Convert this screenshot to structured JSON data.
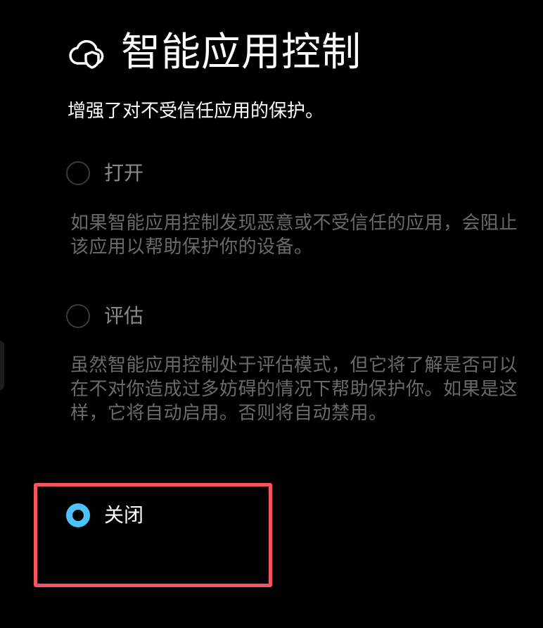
{
  "header": {
    "icon": "cloud-shield-icon",
    "title": "智能应用控制"
  },
  "subtitle": "增强了对不受信任应用的保护。",
  "options": [
    {
      "label": "打开",
      "description": "如果智能应用控制发现恶意或不受信任的应用，会阻止该应用以帮助保护你的设备。",
      "selected": false
    },
    {
      "label": "评估",
      "description": "虽然智能应用控制处于评估模式，但它将了解是否可以在不对你造成过多妨碍的情况下帮助保护你。如果是这样，它将自动启用。否则将自动禁用。",
      "selected": false
    },
    {
      "label": "关闭",
      "selected": true
    }
  ],
  "colors": {
    "background": "#000000",
    "accent": "#4cc2ff",
    "highlight": "#f3565c",
    "disabled_text": "#8a8a8a"
  }
}
